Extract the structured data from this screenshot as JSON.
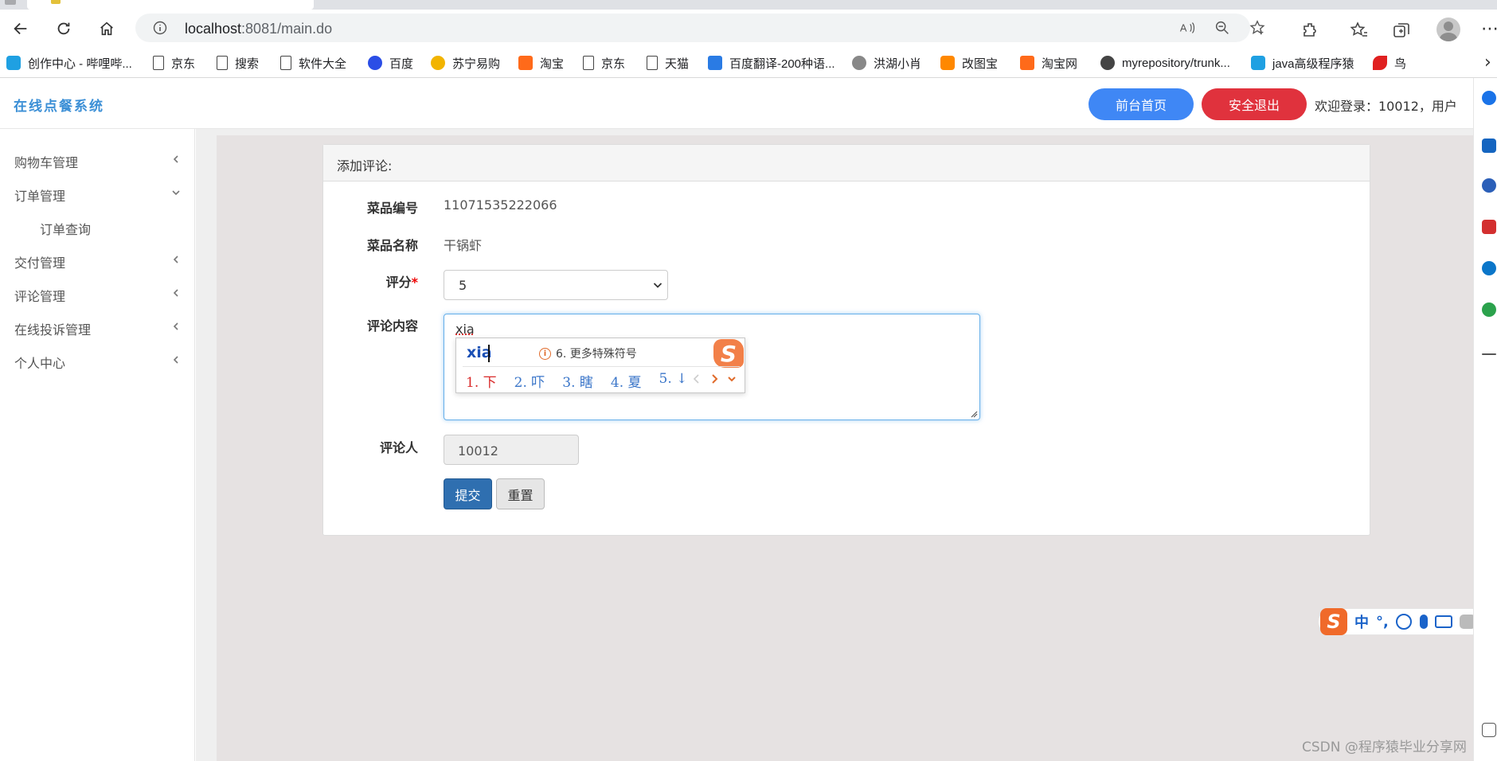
{
  "browser": {
    "url_host": "localhost",
    "url_rest": ":8081/main.do",
    "bookmarks": [
      {
        "label": "创作中心 - 哔哩哔...",
        "icon": "bilibili-icon"
      },
      {
        "label": "京东",
        "icon": "page-icon"
      },
      {
        "label": "搜索",
        "icon": "page-icon"
      },
      {
        "label": "软件大全",
        "icon": "page-icon"
      },
      {
        "label": "百度",
        "icon": "baidu-icon"
      },
      {
        "label": "苏宁易购",
        "icon": "suning-icon"
      },
      {
        "label": "淘宝",
        "icon": "taobao-icon"
      },
      {
        "label": "京东",
        "icon": "page-icon"
      },
      {
        "label": "天猫",
        "icon": "page-icon"
      },
      {
        "label": "百度翻译-200种语...",
        "icon": "baidu-translate-icon"
      },
      {
        "label": "洪湖小肖",
        "icon": "hongwu-icon"
      },
      {
        "label": "改图宝",
        "icon": "gaitubao-icon"
      },
      {
        "label": "淘宝网",
        "icon": "taobao-icon"
      },
      {
        "label": "myrepository/trunk...",
        "icon": "repo-icon"
      },
      {
        "label": "java高级程序猿",
        "icon": "bilibili-icon"
      },
      {
        "label": "鸟",
        "icon": "bird-icon"
      }
    ]
  },
  "app": {
    "brand": "在线点餐系统",
    "front_button": "前台首页",
    "logout_button": "安全退出",
    "welcome": "欢迎登录：10012，用户"
  },
  "sidebar": {
    "items": [
      {
        "label": "购物车管理"
      },
      {
        "label": "订单管理"
      },
      {
        "label": "订单查询"
      },
      {
        "label": "交付管理"
      },
      {
        "label": "评论管理"
      },
      {
        "label": "在线投诉管理"
      },
      {
        "label": "个人中心"
      }
    ]
  },
  "form": {
    "title": "添加评论:",
    "dish_id_label": "菜品编号",
    "dish_id_value": "11071535222066",
    "dish_name_label": "菜品名称",
    "dish_name_value": "干锅虾",
    "rating_label": "评分",
    "rating_required_mark": "*",
    "rating_value": "5",
    "content_label": "评论内容",
    "content_value": "xia",
    "reviewer_label": "评论人",
    "reviewer_value": "10012",
    "submit_label": "提交",
    "reset_label": "重置"
  },
  "ime": {
    "input": "xia",
    "hint": "6. 更多特殊符号",
    "candidates": [
      "1. 下",
      "2. 吓",
      "3. 瞎",
      "4. 夏",
      "5. ↓"
    ],
    "logo": "S",
    "bar_lang": "中",
    "bar_punct": "°,"
  },
  "watermark": "CSDN @程序猿毕业分享网",
  "colors": {
    "brand": "#3b8fd6",
    "front_button": "#3f87f5",
    "logout_button": "#e0323d",
    "submit_button": "#2f6fb0"
  }
}
